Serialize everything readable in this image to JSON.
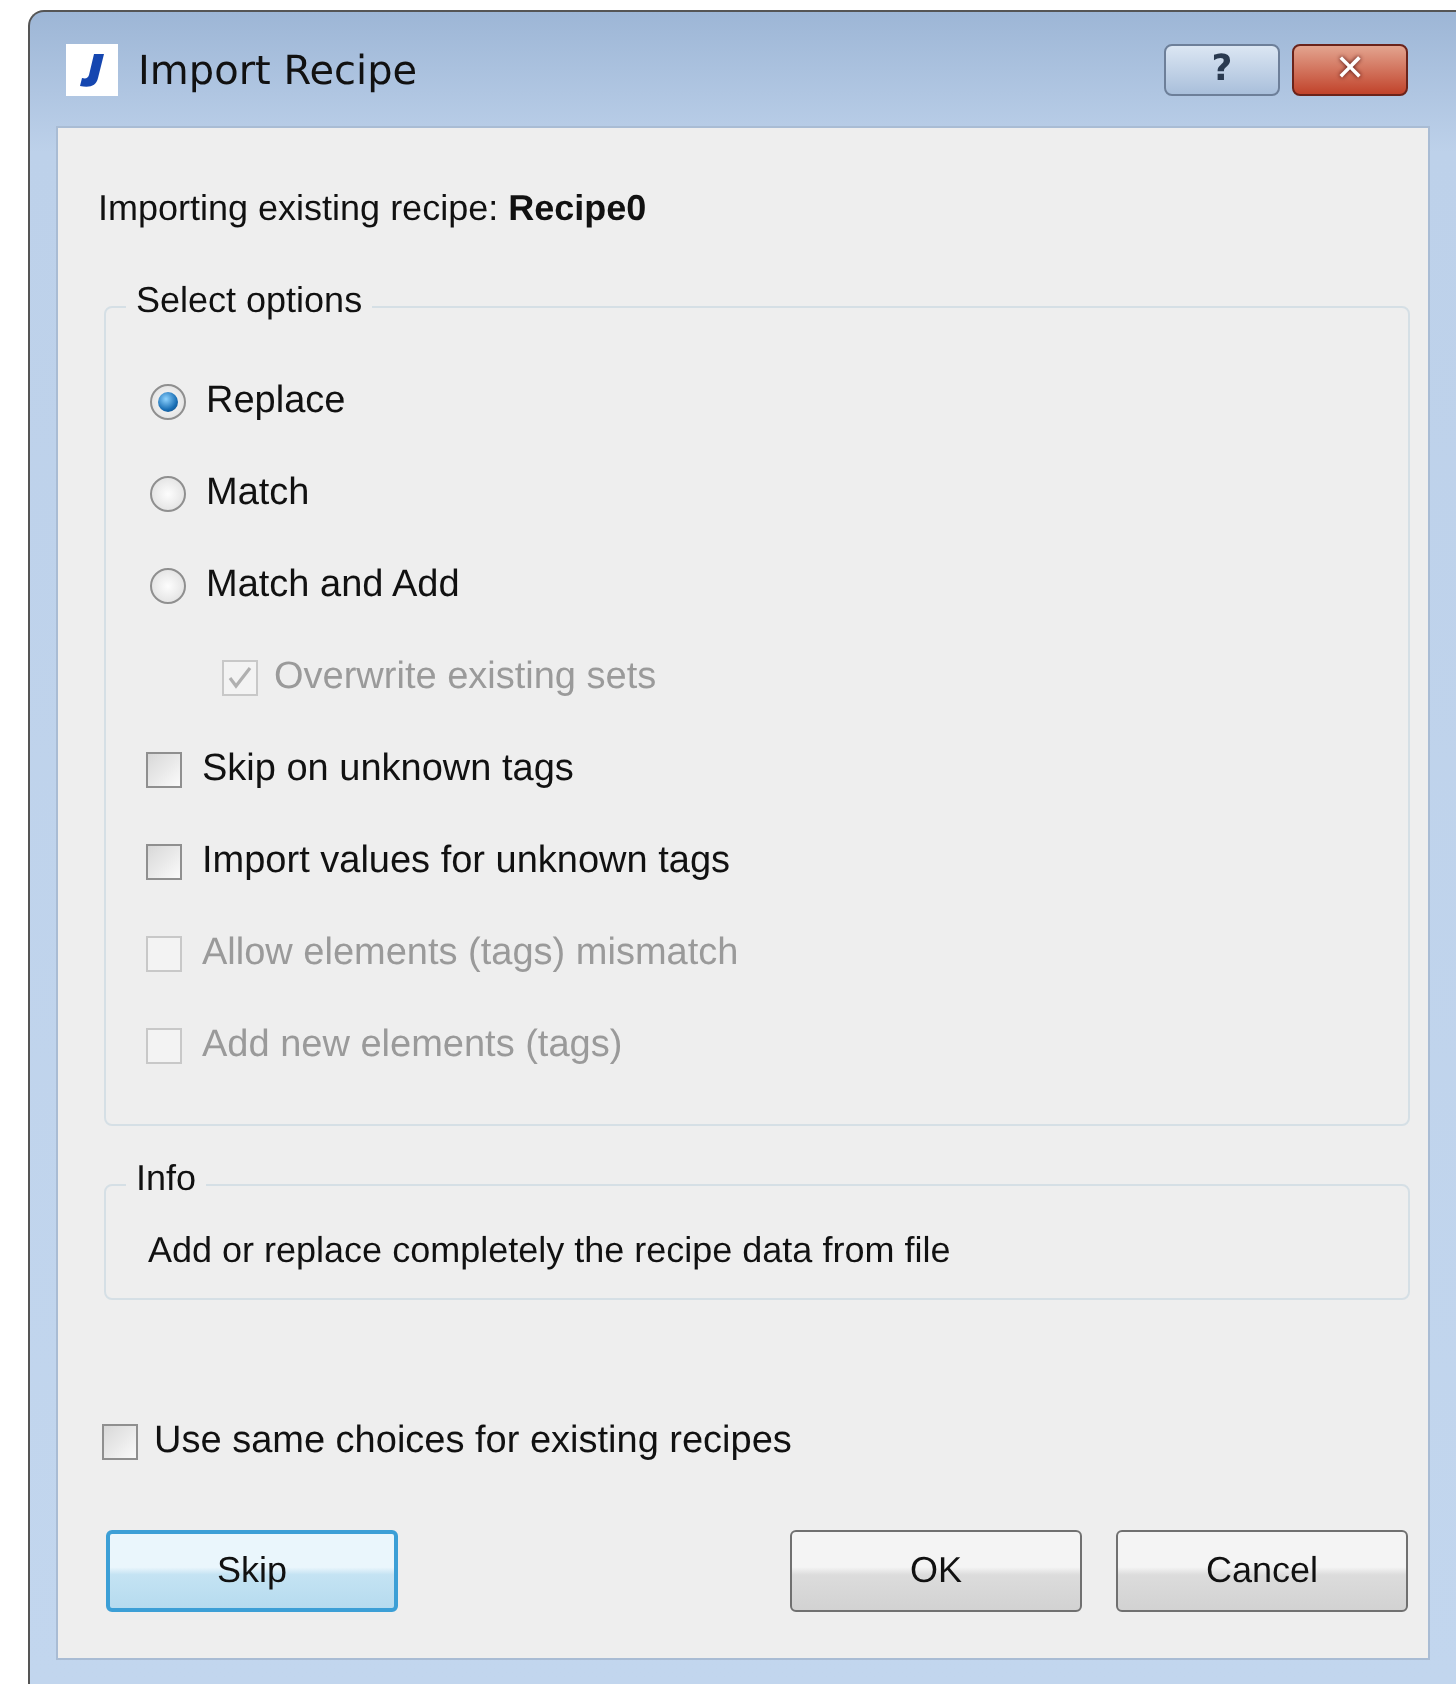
{
  "window": {
    "title": "Import Recipe",
    "buttons": [
      {
        "kind": "help",
        "label": "?"
      },
      {
        "kind": "close",
        "label": "✕"
      }
    ]
  },
  "heading": "Importing existing recipe: **Recipe0**",
  "options_group": {
    "title": "Select options",
    "items": [
      {
        "kind": "radio",
        "label": "Replace",
        "selected": true,
        "disabled": false
      },
      {
        "kind": "radio",
        "label": "Match",
        "selected": false,
        "disabled": false
      },
      {
        "kind": "radio",
        "label": "Match and Add",
        "selected": false,
        "disabled": false,
        "children": [
          {
            "kind": "checkbox",
            "label": "Overwrite existing sets",
            "checked": true,
            "disabled": true
          }
        ]
      },
      {
        "kind": "checkbox",
        "label": "Skip on unknown tags",
        "checked": false,
        "disabled": false
      },
      {
        "kind": "checkbox",
        "label": "Import values for unknown tags",
        "checked": false,
        "disabled": false
      },
      {
        "kind": "checkbox",
        "label": "Allow elements (tags) mismatch",
        "checked": false,
        "disabled": true
      },
      {
        "kind": "checkbox",
        "label": "Add new elements (tags)",
        "checked": false,
        "disabled": true
      }
    ]
  },
  "info_group": {
    "title": "Info",
    "text": "Add or replace completely the recipe data from file"
  },
  "same_choices": {
    "label": "Use same choices for existing recipes",
    "checked": false
  },
  "buttons": [
    {
      "label": "Skip",
      "default": true
    },
    {
      "label": "OK",
      "default": false
    },
    {
      "label": "Cancel",
      "default": false
    }
  ]
}
